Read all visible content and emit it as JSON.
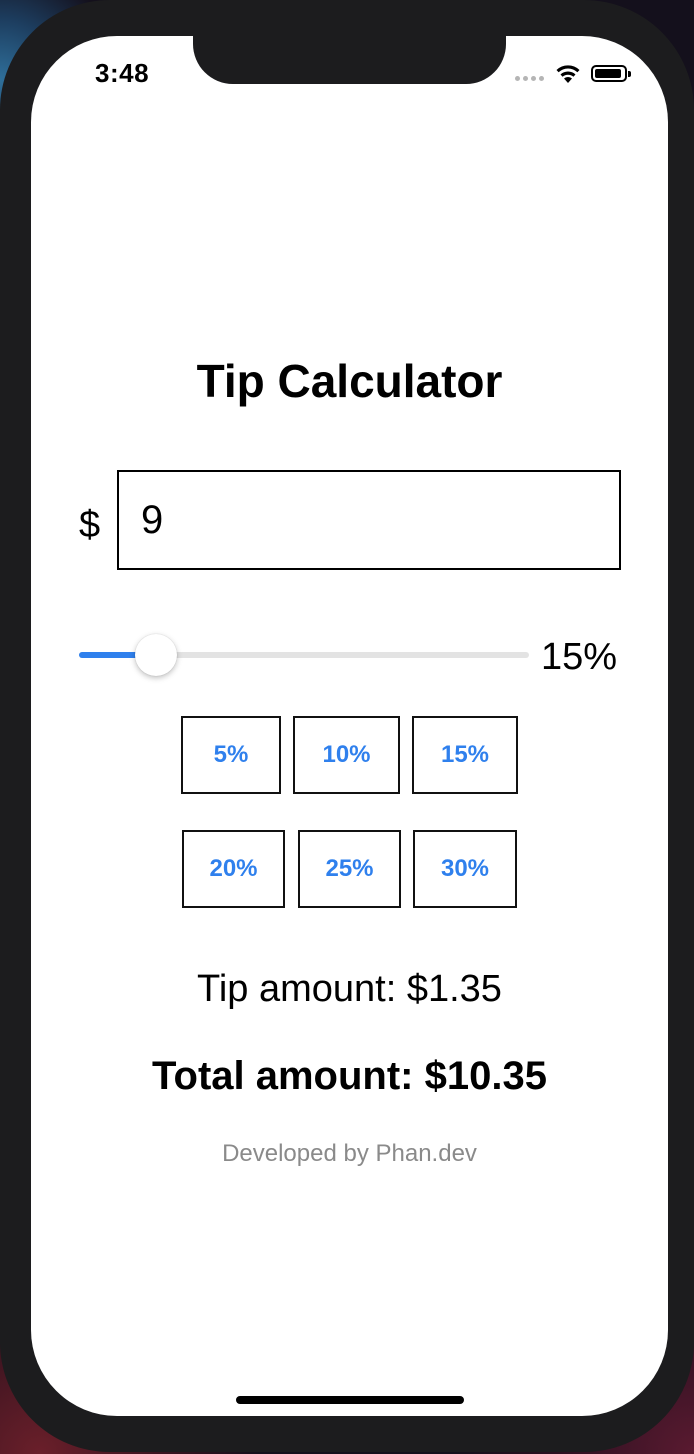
{
  "status_bar": {
    "time": "3:48",
    "icons": [
      "signal-icon",
      "wifi-icon",
      "battery-icon"
    ]
  },
  "app": {
    "title": "Tip Calculator",
    "currency_symbol": "$",
    "bill_amount": "9",
    "tip_percent": 15,
    "tip_percent_label": "15%",
    "slider": {
      "min_percent": 0,
      "max_percent": 100,
      "value_fraction": 0.17
    },
    "presets": [
      {
        "label": "5%"
      },
      {
        "label": "10%"
      },
      {
        "label": "15%"
      },
      {
        "label": "20%"
      },
      {
        "label": "25%"
      },
      {
        "label": "30%"
      }
    ],
    "tip_amount_text": "Tip amount: $1.35",
    "total_amount_text": "Total amount: $10.35",
    "footer": "Developed by Phan.dev"
  },
  "colors": {
    "accent": "#2f80ed",
    "text": "#000000",
    "muted": "#8a8a8a",
    "track": "#e3e3e3"
  }
}
